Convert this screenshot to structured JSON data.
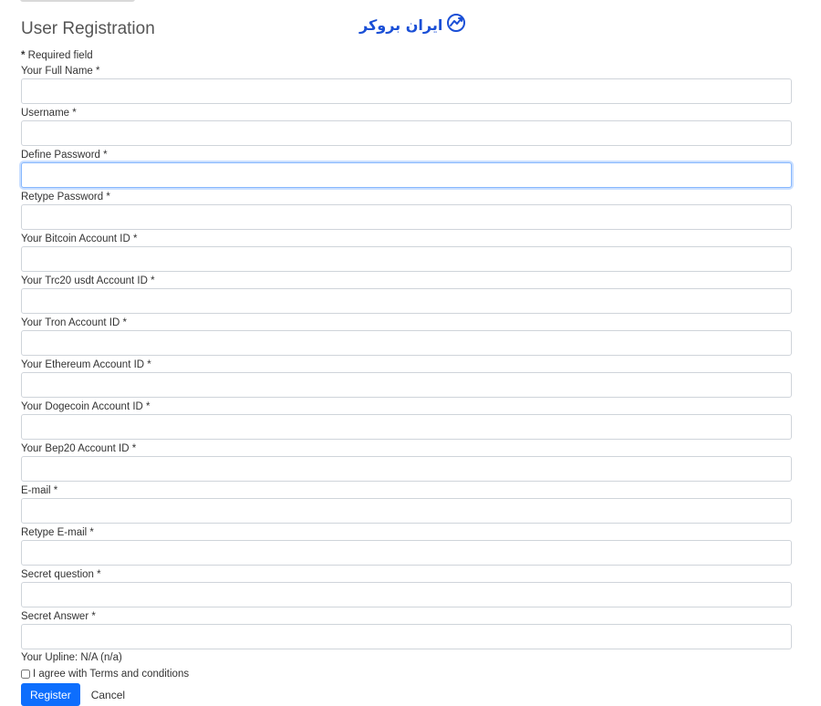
{
  "header": {
    "title": "User Registration",
    "logo_text": "ایران بروکر",
    "logo_icon": "trend-chart-icon",
    "brand_color": "#1a4fd6"
  },
  "required_note": {
    "marker": "*",
    "text": " Required field"
  },
  "fields": [
    {
      "label": "Your Full Name *",
      "value": ""
    },
    {
      "label": "Username *",
      "value": ""
    },
    {
      "label": "Define Password *",
      "value": "",
      "focused": true
    },
    {
      "label": "Retype Password *",
      "value": ""
    },
    {
      "label": "Your Bitcoin Account ID *",
      "value": ""
    },
    {
      "label": "Your Trc20 usdt Account ID *",
      "value": ""
    },
    {
      "label": "Your Tron Account ID *",
      "value": ""
    },
    {
      "label": "Your Ethereum Account ID *",
      "value": ""
    },
    {
      "label": "Your Dogecoin Account ID *",
      "value": ""
    },
    {
      "label": "Your Bep20 Account ID *",
      "value": ""
    },
    {
      "label": "E-mail *",
      "value": ""
    },
    {
      "label": "Retype E-mail *",
      "value": ""
    },
    {
      "label": "Secret question *",
      "value": ""
    },
    {
      "label": "Secret Answer *",
      "value": ""
    }
  ],
  "upline": "Your Upline: N/A (n/a)",
  "agree": {
    "label": "I agree with Terms and conditions",
    "checked": false
  },
  "actions": {
    "register_label": "Register",
    "cancel_label": "Cancel",
    "primary_color": "#0d6efd"
  }
}
